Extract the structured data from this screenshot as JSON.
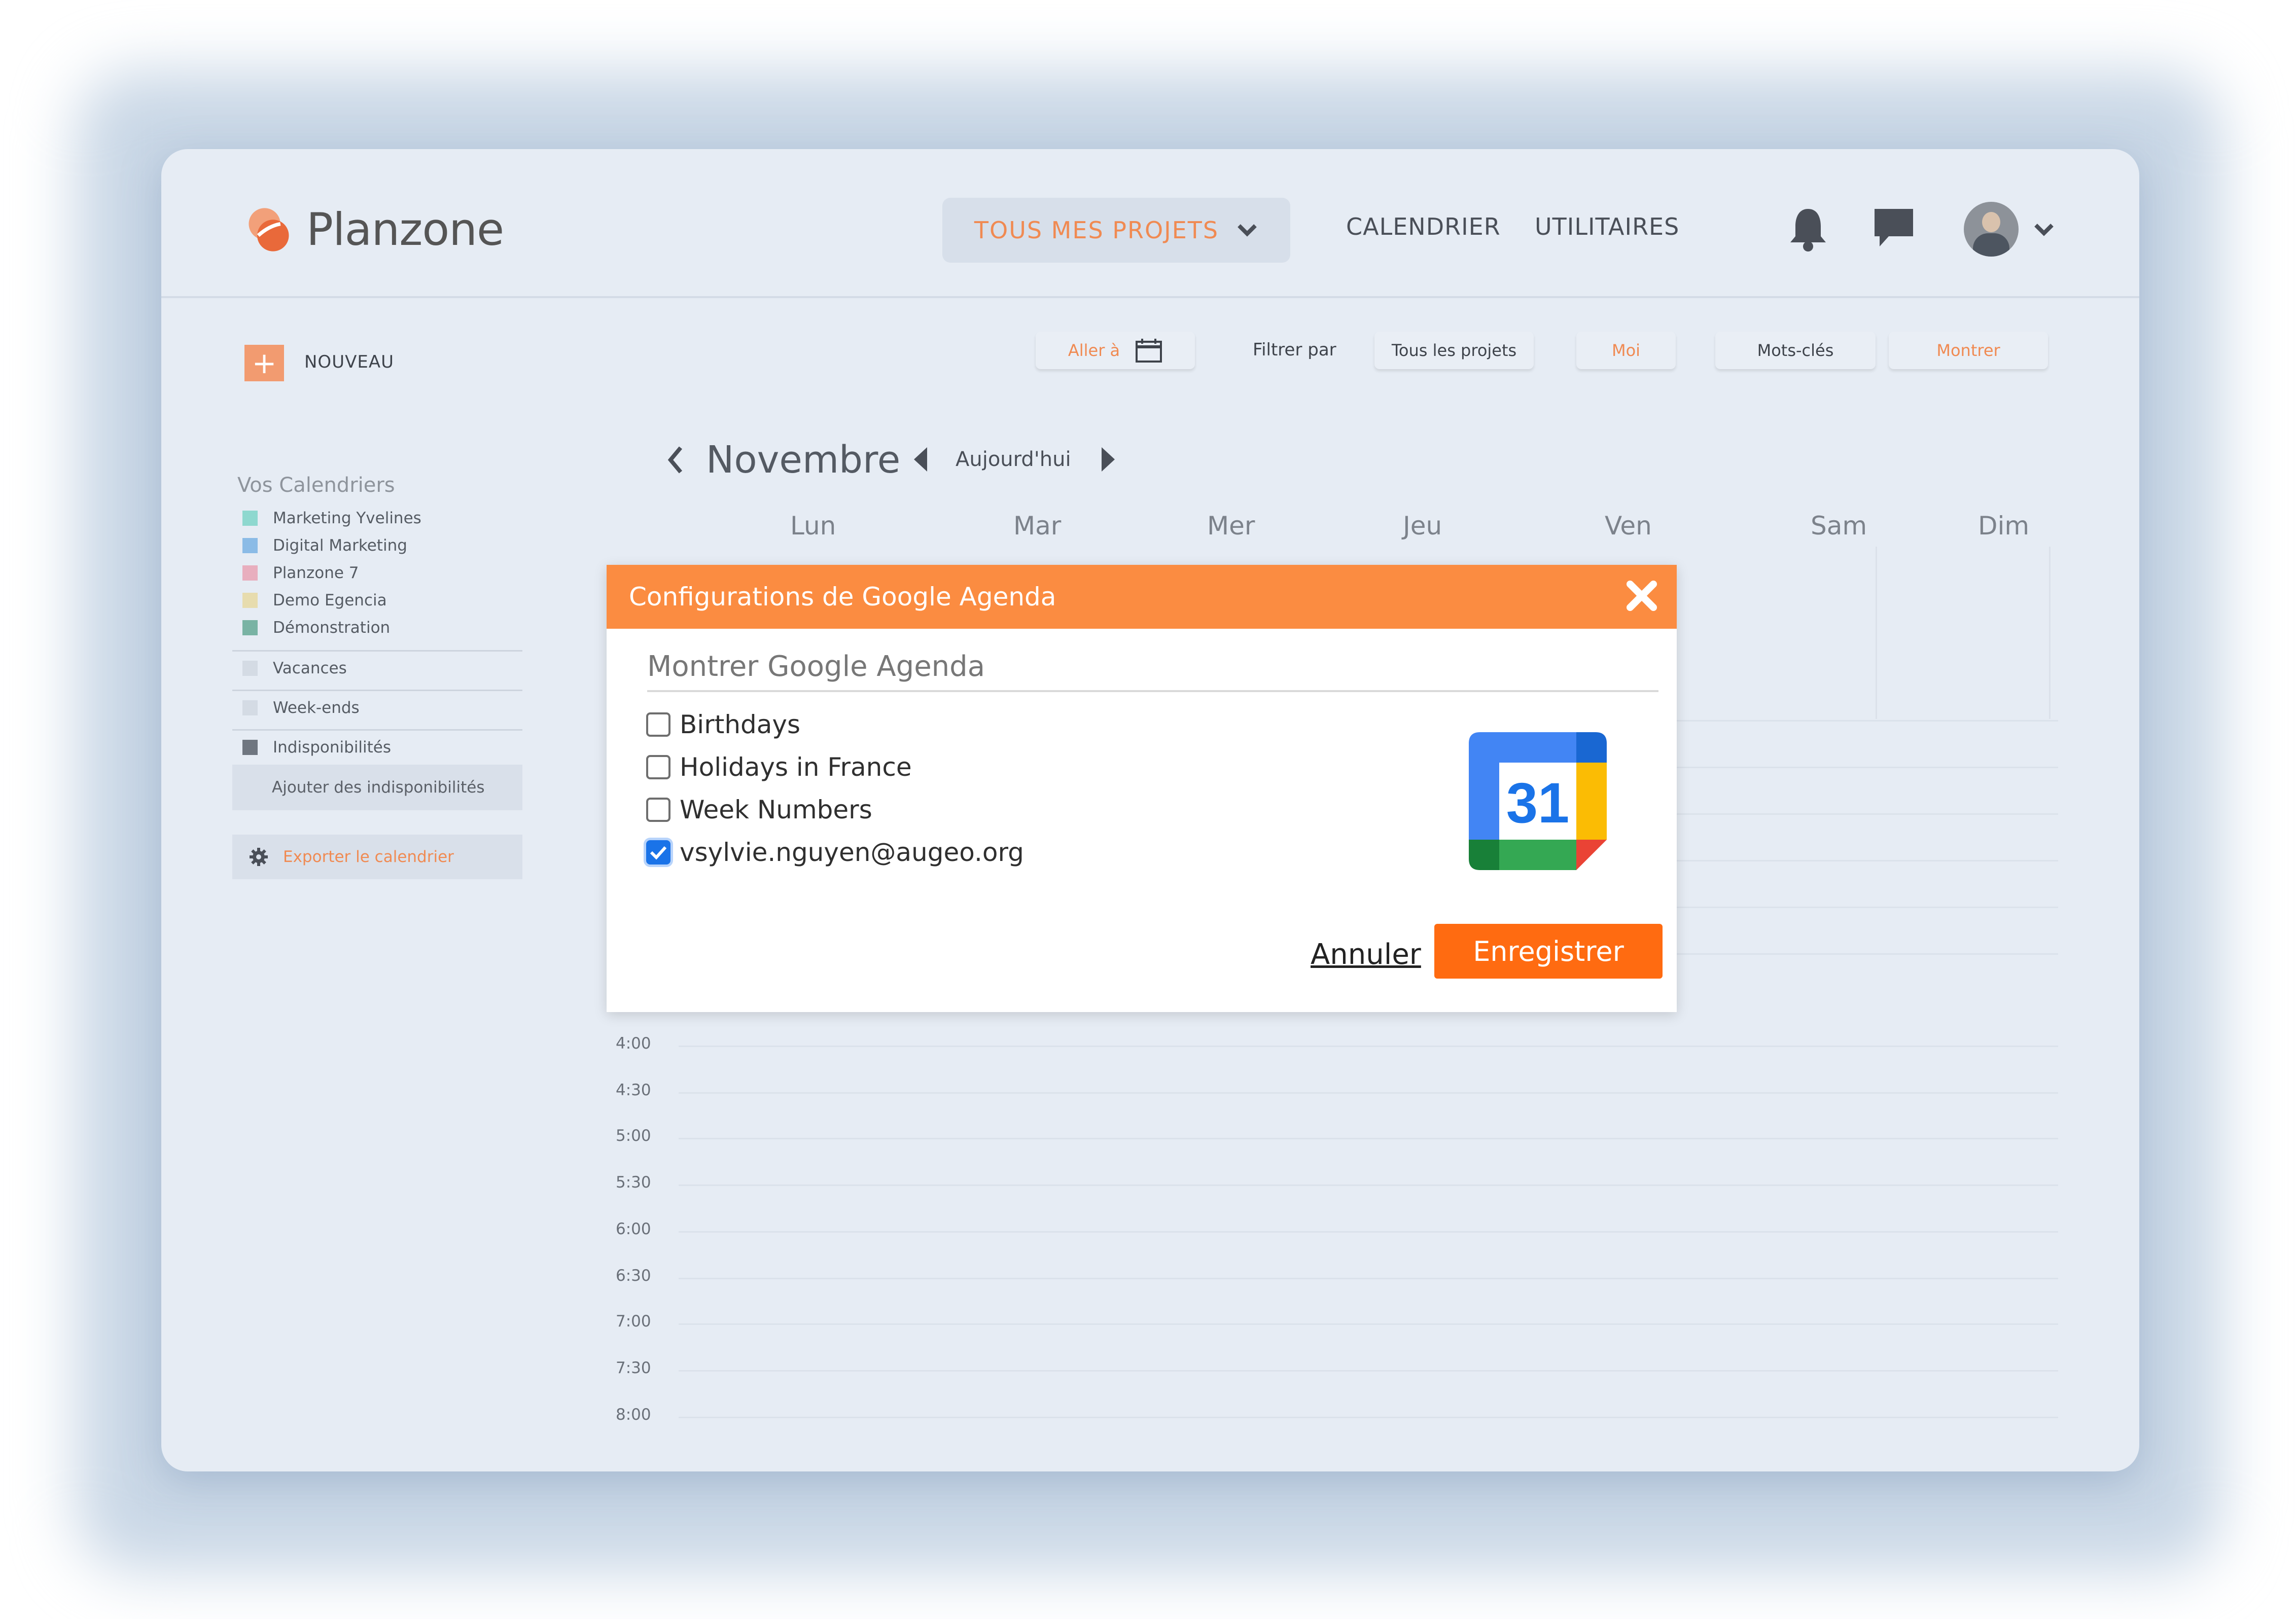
{
  "header": {
    "logo_text": "Planzone",
    "project_select": "TOUS MES PROJETS",
    "nav": [
      "CALENDRIER",
      "UTILITAIRES"
    ]
  },
  "toolbar": {
    "new_label": "NOUVEAU",
    "goto_label": "Aller à",
    "filter_label": "Filtrer par",
    "filter_projects": "Tous les projets",
    "filter_me": "Moi",
    "keywords": "Mots-clés",
    "show": "Montrer"
  },
  "sidebar": {
    "title": "Vos Calendriers",
    "calendars": [
      {
        "label": "Marketing Yvelines",
        "color": "#8ed8cf"
      },
      {
        "label": "Digital Marketing",
        "color": "#8bbbe6"
      },
      {
        "label": "Planzone 7",
        "color": "#e8aebe"
      },
      {
        "label": "Demo Egencia",
        "color": "#e7dcae"
      },
      {
        "label": "Démonstration",
        "color": "#79b3a4"
      }
    ],
    "extras": [
      {
        "label": "Vacances",
        "color": "#d4dbe4"
      },
      {
        "label": "Week-ends",
        "color": "#d4dbe4"
      },
      {
        "label": "Indisponibilités",
        "color": "#6f7680"
      }
    ],
    "add_unavailability": "Ajouter des indisponibilités",
    "export": "Exporter le calendrier"
  },
  "calendar": {
    "month": "Novembre",
    "today": "Aujourd'hui",
    "days": [
      "Lun",
      "Mar",
      "Mer",
      "Jeu",
      "Ven",
      "Sam",
      "Dim"
    ],
    "times": [
      "4:00",
      "4:30",
      "5:00",
      "5:30",
      "6:00",
      "6:30",
      "7:00",
      "7:30",
      "8:00"
    ]
  },
  "modal": {
    "title": "Configurations de Google Agenda",
    "subtitle": "Montrer Google Agenda",
    "options": [
      {
        "label": "Birthdays",
        "checked": false
      },
      {
        "label": "Holidays in France",
        "checked": false
      },
      {
        "label": "Week Numbers",
        "checked": false
      },
      {
        "label": "vsylvie.nguyen@augeo.org",
        "checked": true
      }
    ],
    "icon_number": "31",
    "cancel": "Annuler",
    "save": "Enregistrer"
  },
  "colors": {
    "accent": "#fb8c41",
    "save_button": "#ff6b11",
    "project_select_text": "#f08a52"
  }
}
